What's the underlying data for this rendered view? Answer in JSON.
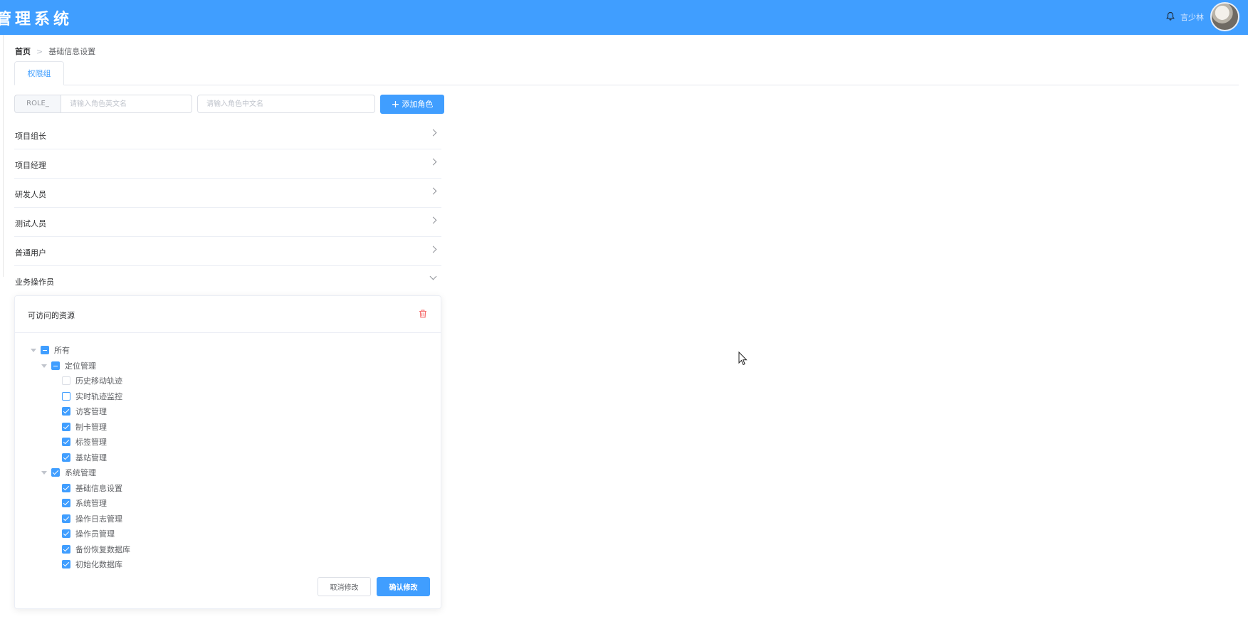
{
  "header": {
    "title": "管理系统",
    "username": "言少林"
  },
  "breadcrumb": {
    "home": "首页",
    "current": "基础信息设置"
  },
  "tabs": [
    {
      "label": "权限组"
    }
  ],
  "toolbar": {
    "prefix": "ROLE_",
    "en_placeholder": "请输入角色英文名",
    "cn_placeholder": "请输入角色中文名",
    "add_label": "添加角色"
  },
  "roles": [
    {
      "label": "项目组长"
    },
    {
      "label": "项目经理"
    },
    {
      "label": "研发人员"
    },
    {
      "label": "测试人员"
    },
    {
      "label": "普通用户"
    },
    {
      "label": "业务操作员"
    }
  ],
  "panel": {
    "title": "可访问的资源",
    "tree": {
      "root": {
        "label": "所有",
        "state": "indeterminate"
      },
      "groups": [
        {
          "label": "定位管理",
          "state": "indeterminate",
          "children": [
            {
              "label": "历史移动轨迹",
              "state": "unchecked"
            },
            {
              "label": "实时轨迹监控",
              "state": "unchecked"
            },
            {
              "label": "访客管理",
              "state": "checked"
            },
            {
              "label": "制卡管理",
              "state": "checked"
            },
            {
              "label": "标签管理",
              "state": "checked"
            },
            {
              "label": "基站管理",
              "state": "checked"
            }
          ]
        },
        {
          "label": "系统管理",
          "state": "checked",
          "children": [
            {
              "label": "基础信息设置",
              "state": "checked"
            },
            {
              "label": "系统管理",
              "state": "checked"
            },
            {
              "label": "操作日志管理",
              "state": "checked"
            },
            {
              "label": "操作员管理",
              "state": "checked"
            },
            {
              "label": "备份恢复数据库",
              "state": "checked"
            },
            {
              "label": "初始化数据库",
              "state": "checked"
            }
          ]
        }
      ]
    },
    "cancel_label": "取消修改",
    "confirm_label": "确认修改"
  },
  "colors": {
    "primary": "#409eff",
    "danger": "#f56c6c"
  }
}
